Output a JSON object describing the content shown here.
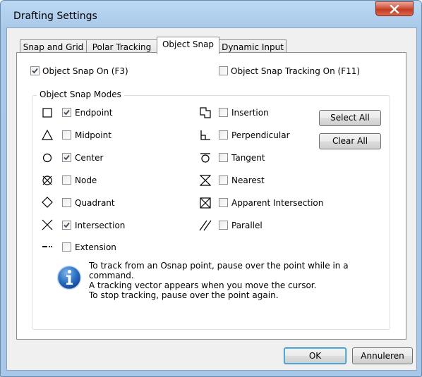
{
  "window": {
    "title": "Drafting Settings"
  },
  "tabs": [
    {
      "label": "Snap and Grid"
    },
    {
      "label": "Polar Tracking"
    },
    {
      "label": "Object Snap"
    },
    {
      "label": "Dynamic Input"
    }
  ],
  "active_tab": "Object Snap",
  "options": {
    "object_snap_on": {
      "label": "Object Snap On (F3)",
      "checked": true
    },
    "object_snap_tracking_on": {
      "label": "Object Snap Tracking On (F11)",
      "checked": false
    }
  },
  "group": {
    "title": "Object Snap Modes"
  },
  "modes_left": [
    {
      "label": "Endpoint",
      "checked": true,
      "icon": "endpoint-square-icon"
    },
    {
      "label": "Midpoint",
      "checked": false,
      "icon": "midpoint-triangle-icon"
    },
    {
      "label": "Center",
      "checked": true,
      "icon": "center-circle-icon"
    },
    {
      "label": "Node",
      "checked": false,
      "icon": "node-circle-x-icon"
    },
    {
      "label": "Quadrant",
      "checked": false,
      "icon": "quadrant-diamond-icon"
    },
    {
      "label": "Intersection",
      "checked": true,
      "icon": "intersection-x-icon"
    },
    {
      "label": "Extension",
      "checked": false,
      "icon": "extension-dashed-line-icon"
    }
  ],
  "modes_right": [
    {
      "label": "Insertion",
      "checked": false,
      "icon": "insertion-icon"
    },
    {
      "label": "Perpendicular",
      "checked": false,
      "icon": "perpendicular-icon"
    },
    {
      "label": "Tangent",
      "checked": false,
      "icon": "tangent-icon"
    },
    {
      "label": "Nearest",
      "checked": false,
      "icon": "nearest-hourglass-icon"
    },
    {
      "label": "Apparent Intersection",
      "checked": false,
      "icon": "apparent-intersection-icon"
    },
    {
      "label": "Parallel",
      "checked": false,
      "icon": "parallel-lines-icon"
    }
  ],
  "buttons": {
    "select_all": "Select All",
    "clear_all": "Clear All",
    "ok": "OK",
    "cancel": "Annuleren"
  },
  "info": {
    "line1": "To track from an Osnap point, pause over the point while in a",
    "line2": "command.",
    "line3": "A tracking vector appears when you move the cursor.",
    "line4": "To stop tracking, pause over the point again."
  },
  "colors": {
    "accent": "#3c7fb1",
    "close_button": "#c43a22",
    "info_icon": "#1f5fa8"
  }
}
